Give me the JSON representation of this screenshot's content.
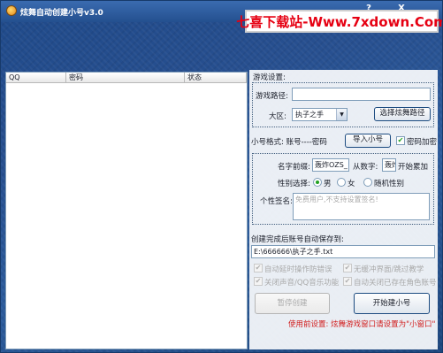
{
  "window": {
    "title": "炫舞自动创建小号v3.0"
  },
  "banner": {
    "text": "七喜下载站-Www.7xdown.Com"
  },
  "controls": {
    "help": "?",
    "minimize": "_",
    "close": "X"
  },
  "list": {
    "columns": [
      "QQ",
      "密码",
      "状态"
    ]
  },
  "game_settings": {
    "section": "游戏设置:",
    "path_label": "游戏路径:",
    "path_value": "",
    "region_label": "大区:",
    "region_value": "执子之手",
    "choose_path_button": "选择炫舞路径"
  },
  "account_format": {
    "label": "小号格式: 账号----密码",
    "import_button": "导入小号",
    "encrypt_label": "密码加密",
    "encrypt_checked": true
  },
  "character": {
    "name_prefix_label": "名字前缀:",
    "name_prefix_value": "轰炸OZS_",
    "digit_label": "从数字:",
    "digit_value": "轰炸",
    "digit_suffix": "开始累加",
    "gender_label": "性别选择:",
    "gender_male": "男",
    "gender_female": "女",
    "gender_random": "随机性别",
    "gender_selected": "男",
    "sign_label": "个性签名:",
    "sign_placeholder": "免费用户,不支持设置签名!"
  },
  "save": {
    "label": "创建完成后账号自动保存到:",
    "path": "E:\\666666\\执子之手.txt"
  },
  "options": {
    "auto_delay": "自动延时操作防错误",
    "no_ui": "无缓冲界面/跳过教学",
    "close_sound": "关闭声音/QQ音乐功能",
    "auto_close_role": "自动关闭已存在角色账号"
  },
  "actions": {
    "pause_button": "暂停创建",
    "start_button": "开始建小号"
  },
  "footer": {
    "note": "使用前设置: 炫舞游戏窗口请设置为\"小窗口\""
  }
}
